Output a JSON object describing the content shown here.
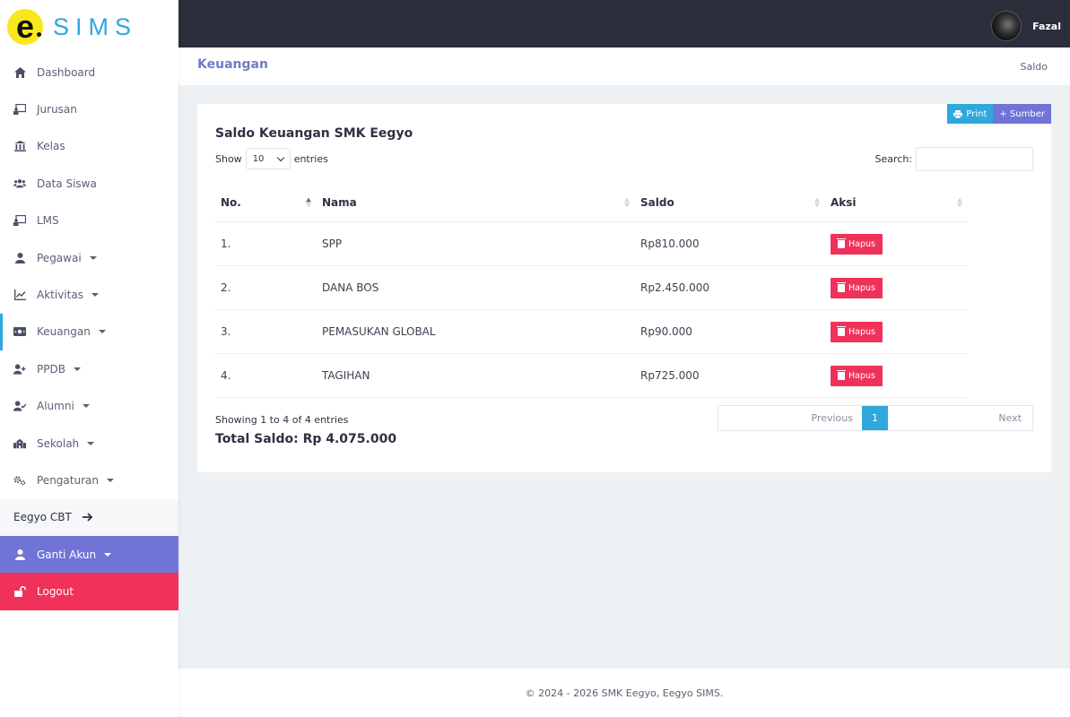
{
  "brand": {
    "logo_letter": "e",
    "name": "SIMS",
    "logo_color": "#f8e71c",
    "name_color": "#2ea8dd"
  },
  "sidebar": {
    "items": [
      {
        "label": "Dashboard",
        "icon": "home-icon"
      },
      {
        "label": "Jurusan",
        "icon": "chalkboard-icon"
      },
      {
        "label": "Kelas",
        "icon": "bank-icon"
      },
      {
        "label": "Data Siswa",
        "icon": "users-icon"
      },
      {
        "label": "LMS",
        "icon": "chalkboard-icon"
      },
      {
        "label": "Pegawai",
        "icon": "user-icon",
        "dropdown": true
      },
      {
        "label": "Aktivitas",
        "icon": "chart-line-icon",
        "dropdown": true
      },
      {
        "label": "Keuangan",
        "icon": "money-icon",
        "dropdown": true,
        "active": true
      },
      {
        "label": "PPDB",
        "icon": "user-plus-icon",
        "dropdown": true
      },
      {
        "label": "Alumni",
        "icon": "user-check-icon",
        "dropdown": true
      },
      {
        "label": "Sekolah",
        "icon": "school-icon",
        "dropdown": true
      },
      {
        "label": "Pengaturan",
        "icon": "gears-icon",
        "dropdown": true
      }
    ],
    "cbt": {
      "label": "Eegyo CBT",
      "icon": "arrow-right-icon"
    },
    "ganti_akun": {
      "label": "Ganti Akun",
      "icon": "user-icon"
    },
    "logout": {
      "label": "Logout",
      "icon": "unlock-icon"
    }
  },
  "topbar": {
    "user_name": "Fazal"
  },
  "page_header": {
    "title": "Keuangan",
    "breadcrumb": "Saldo"
  },
  "card": {
    "print_label": "Print",
    "sumber_label": "+ Sumber",
    "title": "Saldo Keuangan SMK Eegyo",
    "show_label": "Show",
    "entries_value": "10",
    "entries_label": "entries",
    "search_label": "Search:",
    "search_value": ""
  },
  "table": {
    "columns": [
      "No.",
      "Nama",
      "Saldo",
      "Aksi"
    ],
    "rows": [
      {
        "no": "1.",
        "nama": "SPP",
        "saldo": "Rp810.000",
        "action": "Hapus"
      },
      {
        "no": "2.",
        "nama": "DANA BOS",
        "saldo": "Rp2.450.000",
        "action": "Hapus"
      },
      {
        "no": "3.",
        "nama": "PEMASUKAN GLOBAL",
        "saldo": "Rp90.000",
        "action": "Hapus"
      },
      {
        "no": "4.",
        "nama": "TAGIHAN",
        "saldo": "Rp725.000",
        "action": "Hapus"
      }
    ]
  },
  "summary": {
    "info": "Showing 1 to 4 of 4 entries",
    "total": "Total Saldo: Rp 4.075.000"
  },
  "pagination": {
    "previous": "Previous",
    "current": "1",
    "next": "Next"
  },
  "footer": {
    "text": "© 2024 - 2026 SMK Eegyo, Eegyo SIMS."
  },
  "colors": {
    "accent": "#2ea8dd",
    "purple": "#7074d6",
    "danger": "#f0325a",
    "topbar": "#2b2e3b"
  }
}
